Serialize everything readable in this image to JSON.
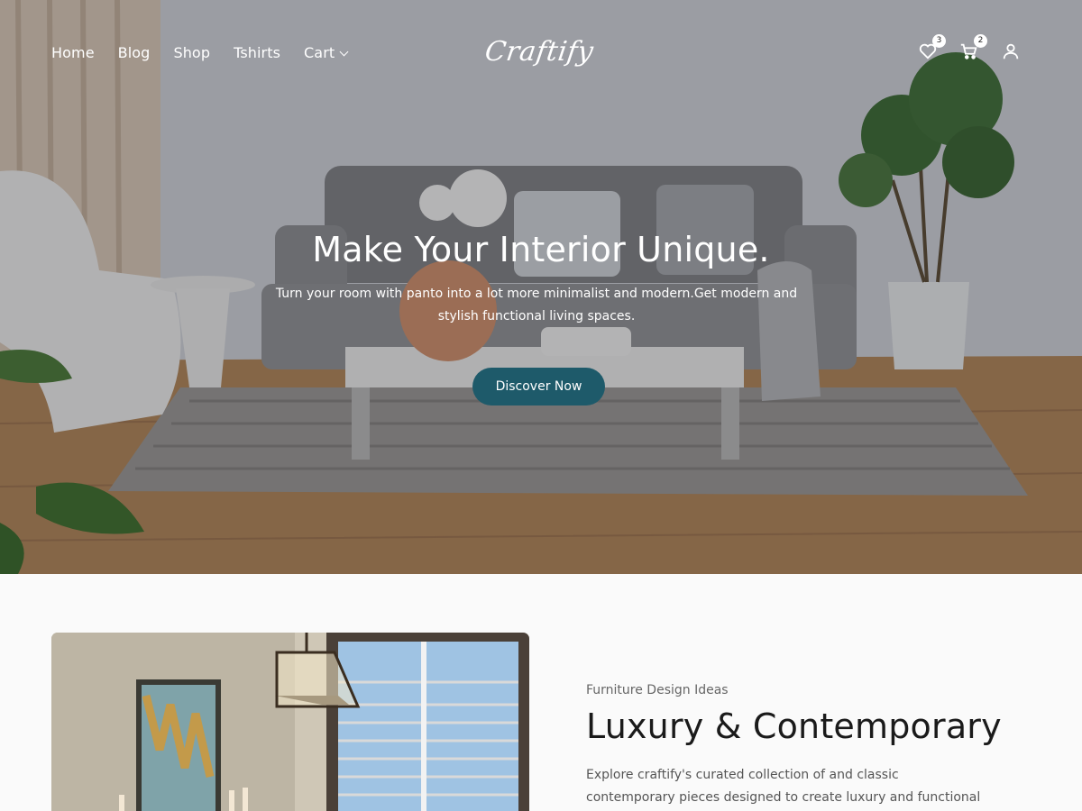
{
  "header": {
    "nav": [
      "Home",
      "Blog",
      "Shop",
      "Tshirts",
      "Cart"
    ],
    "logo_text": "Craftify",
    "wishlist_count": "3",
    "cart_count": "2"
  },
  "hero": {
    "title": "Make Your Interior Unique.",
    "subtitle": "Turn your room with panto into a lot more minimalist and modern.Get modern and stylish functional living spaces.",
    "button_label": "Discover Now"
  },
  "feature": {
    "eyebrow": "Furniture Design Ideas",
    "title": "Luxury & Contemporary",
    "description": "Explore craftify's curated collection of and classic contemporary pieces designed to create luxury and functional living spaces. Get"
  },
  "colors": {
    "accent": "#1e5a6a"
  }
}
